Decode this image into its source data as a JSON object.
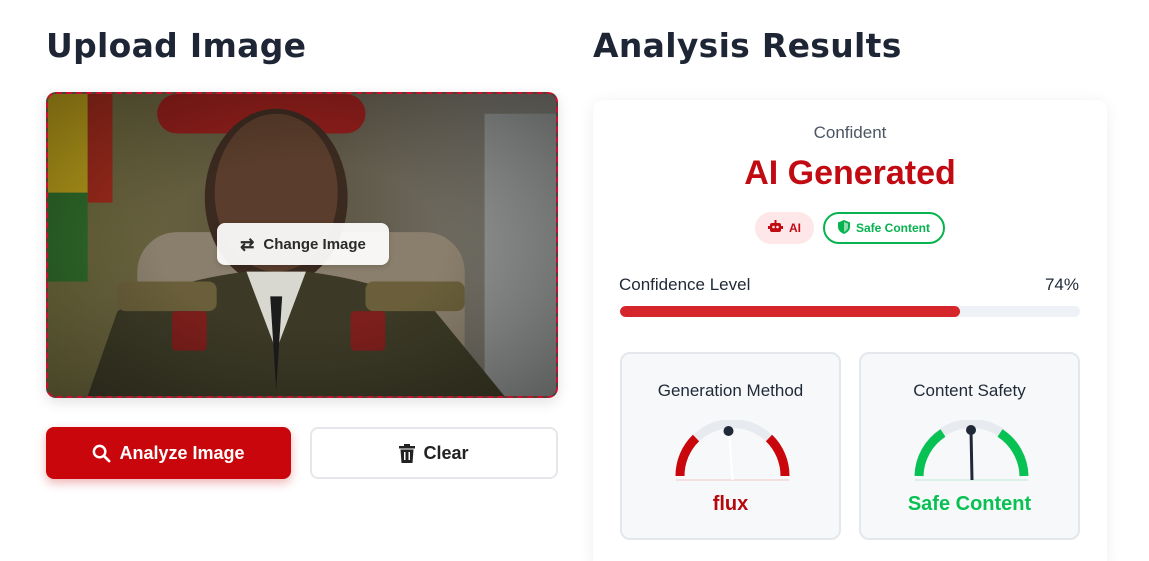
{
  "upload": {
    "heading": "Upload Image",
    "change_image_label": "Change Image",
    "analyze_label": "Analyze Image",
    "clear_label": "Clear"
  },
  "results": {
    "heading": "Analysis Results",
    "verdict_label": "Confident",
    "verdict_title": "AI Generated",
    "badges": {
      "ai": "AI",
      "safe": "Safe Content"
    },
    "confidence": {
      "label": "Confidence Level",
      "value_text": "74%",
      "fraction": 0.74
    },
    "generation": {
      "title": "Generation Method",
      "value": "flux"
    },
    "safety": {
      "title": "Content Safety",
      "value": "Safe Content"
    }
  },
  "colors": {
    "accent": "#c8060b",
    "danger": "#c20a12",
    "safe": "#07b34f"
  },
  "icons": {
    "change": "swap-arrows-icon",
    "analyze": "search-icon",
    "clear": "trash-icon",
    "ai_badge": "robot-icon",
    "safe_badge": "shield-icon"
  }
}
